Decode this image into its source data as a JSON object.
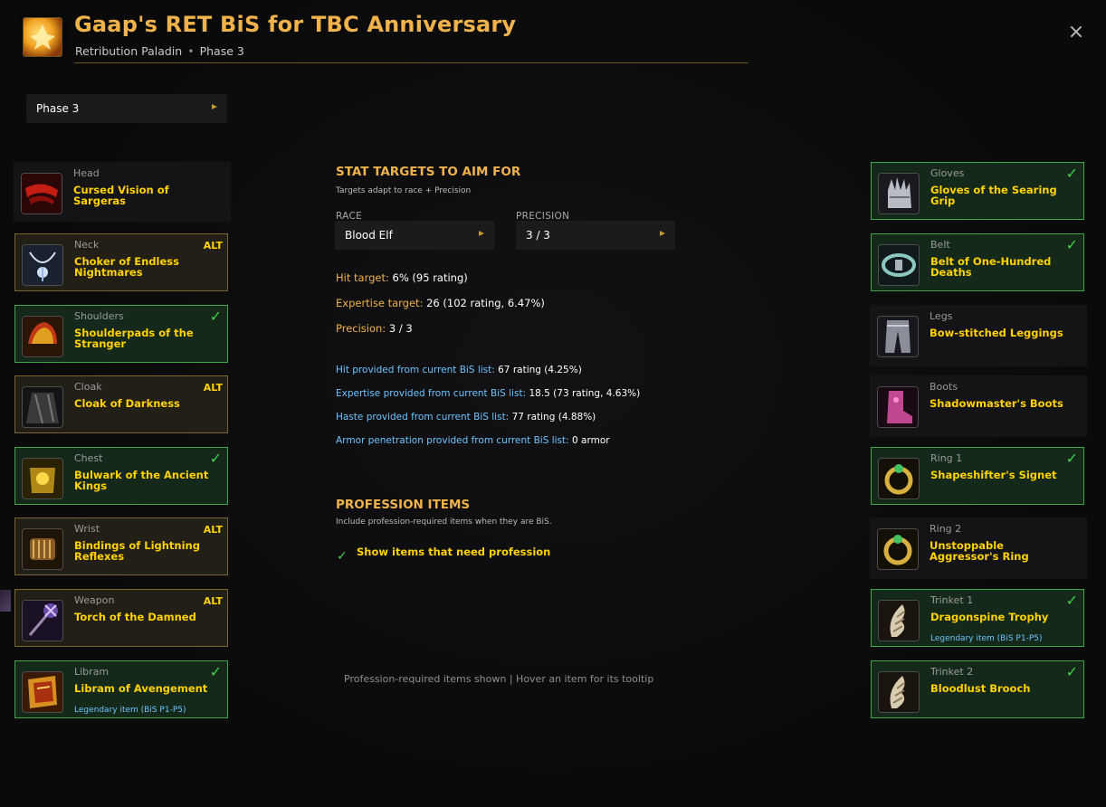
{
  "header": {
    "title": "Gaap's RET BiS for TBC Anniversary",
    "class_spec": "Retribution Paladin",
    "separator": "•",
    "phase": "Phase 3",
    "close_label": "×"
  },
  "phase_select": {
    "value": "Phase 3"
  },
  "left_slots": [
    {
      "slot": "Head",
      "item": "Cursed Vision of Sargeras",
      "status": "plain",
      "badge": "",
      "note": "",
      "icon": "head-icon"
    },
    {
      "slot": "Neck",
      "item": "Choker of Endless Nightmares",
      "status": "alt",
      "badge": "ALT",
      "note": "",
      "icon": "neck-icon"
    },
    {
      "slot": "Shoulders",
      "item": "Shoulderpads of the Stranger",
      "status": "check",
      "badge": "✓",
      "note": "",
      "icon": "shoulders-icon"
    },
    {
      "slot": "Cloak",
      "item": "Cloak of Darkness",
      "status": "alt",
      "badge": "ALT",
      "note": "",
      "icon": "cloak-icon"
    },
    {
      "slot": "Chest",
      "item": "Bulwark of the Ancient Kings",
      "status": "check",
      "badge": "✓",
      "note": "",
      "icon": "chest-icon"
    },
    {
      "slot": "Wrist",
      "item": "Bindings of Lightning Reflexes",
      "status": "alt",
      "badge": "ALT",
      "note": "",
      "icon": "wrist-icon"
    },
    {
      "slot": "Weapon",
      "item": "Torch of the Damned",
      "status": "alt",
      "badge": "ALT",
      "note": "",
      "icon": "weapon-icon"
    },
    {
      "slot": "Libram",
      "item": "Libram of Avengement",
      "status": "check",
      "badge": "✓",
      "note": "Legendary item (BiS P1-P5)",
      "icon": "libram-icon"
    }
  ],
  "right_slots": [
    {
      "slot": "Gloves",
      "item": "Gloves of the Searing Grip",
      "status": "check",
      "badge": "✓",
      "note": "",
      "icon": "gloves-icon"
    },
    {
      "slot": "Belt",
      "item": "Belt of One-Hundred Deaths",
      "status": "check",
      "badge": "✓",
      "note": "",
      "icon": "belt-icon"
    },
    {
      "slot": "Legs",
      "item": "Bow-stitched Leggings",
      "status": "plain",
      "badge": "",
      "note": "",
      "icon": "legs-icon"
    },
    {
      "slot": "Boots",
      "item": "Shadowmaster's Boots",
      "status": "plain",
      "badge": "",
      "note": "",
      "icon": "boots-icon"
    },
    {
      "slot": "Ring 1",
      "item": "Shapeshifter's Signet",
      "status": "check",
      "badge": "✓",
      "note": "",
      "icon": "ring-icon"
    },
    {
      "slot": "Ring 2",
      "item": "Unstoppable Aggressor's Ring",
      "status": "plain",
      "badge": "",
      "note": "",
      "icon": "ring-icon"
    },
    {
      "slot": "Trinket 1",
      "item": "Dragonspine Trophy",
      "status": "check",
      "badge": "✓",
      "note": "Legendary item (BiS P1-P5)",
      "icon": "trinket-icon"
    },
    {
      "slot": "Trinket 2",
      "item": "Bloodlust Brooch",
      "status": "check",
      "badge": "✓",
      "note": "",
      "icon": "trinket-icon"
    }
  ],
  "stats": {
    "title": "STAT TARGETS TO AIM FOR",
    "subtitle": "Targets adapt to race + Precision",
    "race_label": "RACE",
    "race_value": "Blood Elf",
    "precision_label": "PRECISION",
    "precision_value": "3 / 3",
    "hit_key": "Hit target:",
    "hit_val": "6% (95 rating)",
    "exp_key": "Expertise target:",
    "exp_val": "26 (102 rating, 6.47%)",
    "prec_key": "Precision:",
    "prec_val": "3 / 3",
    "prov_hit_key": "Hit provided from current BiS list:",
    "prov_hit_val": "67 rating (4.25%)",
    "prov_exp_key": "Expertise provided from current BiS list:",
    "prov_exp_val": "18.5 (73 rating, 4.63%)",
    "prov_haste_key": "Haste provided from current BiS list:",
    "prov_haste_val": "77 rating (4.88%)",
    "prov_arp_key": "Armor penetration provided from current BiS list:",
    "prov_arp_val": "0 armor"
  },
  "profession": {
    "title": "PROFESSION ITEMS",
    "subtitle": "Include profession-required items when they are BiS.",
    "checkbox_label": "Show items that need profession",
    "checked": true
  },
  "footer": {
    "text": "Profession-required items shown  |  Hover an item for its tooltip"
  },
  "colors": {
    "accent": "#f0b24a",
    "item": "#ffd200",
    "check": "#41d14f",
    "legendary": "#6ec4ff"
  }
}
